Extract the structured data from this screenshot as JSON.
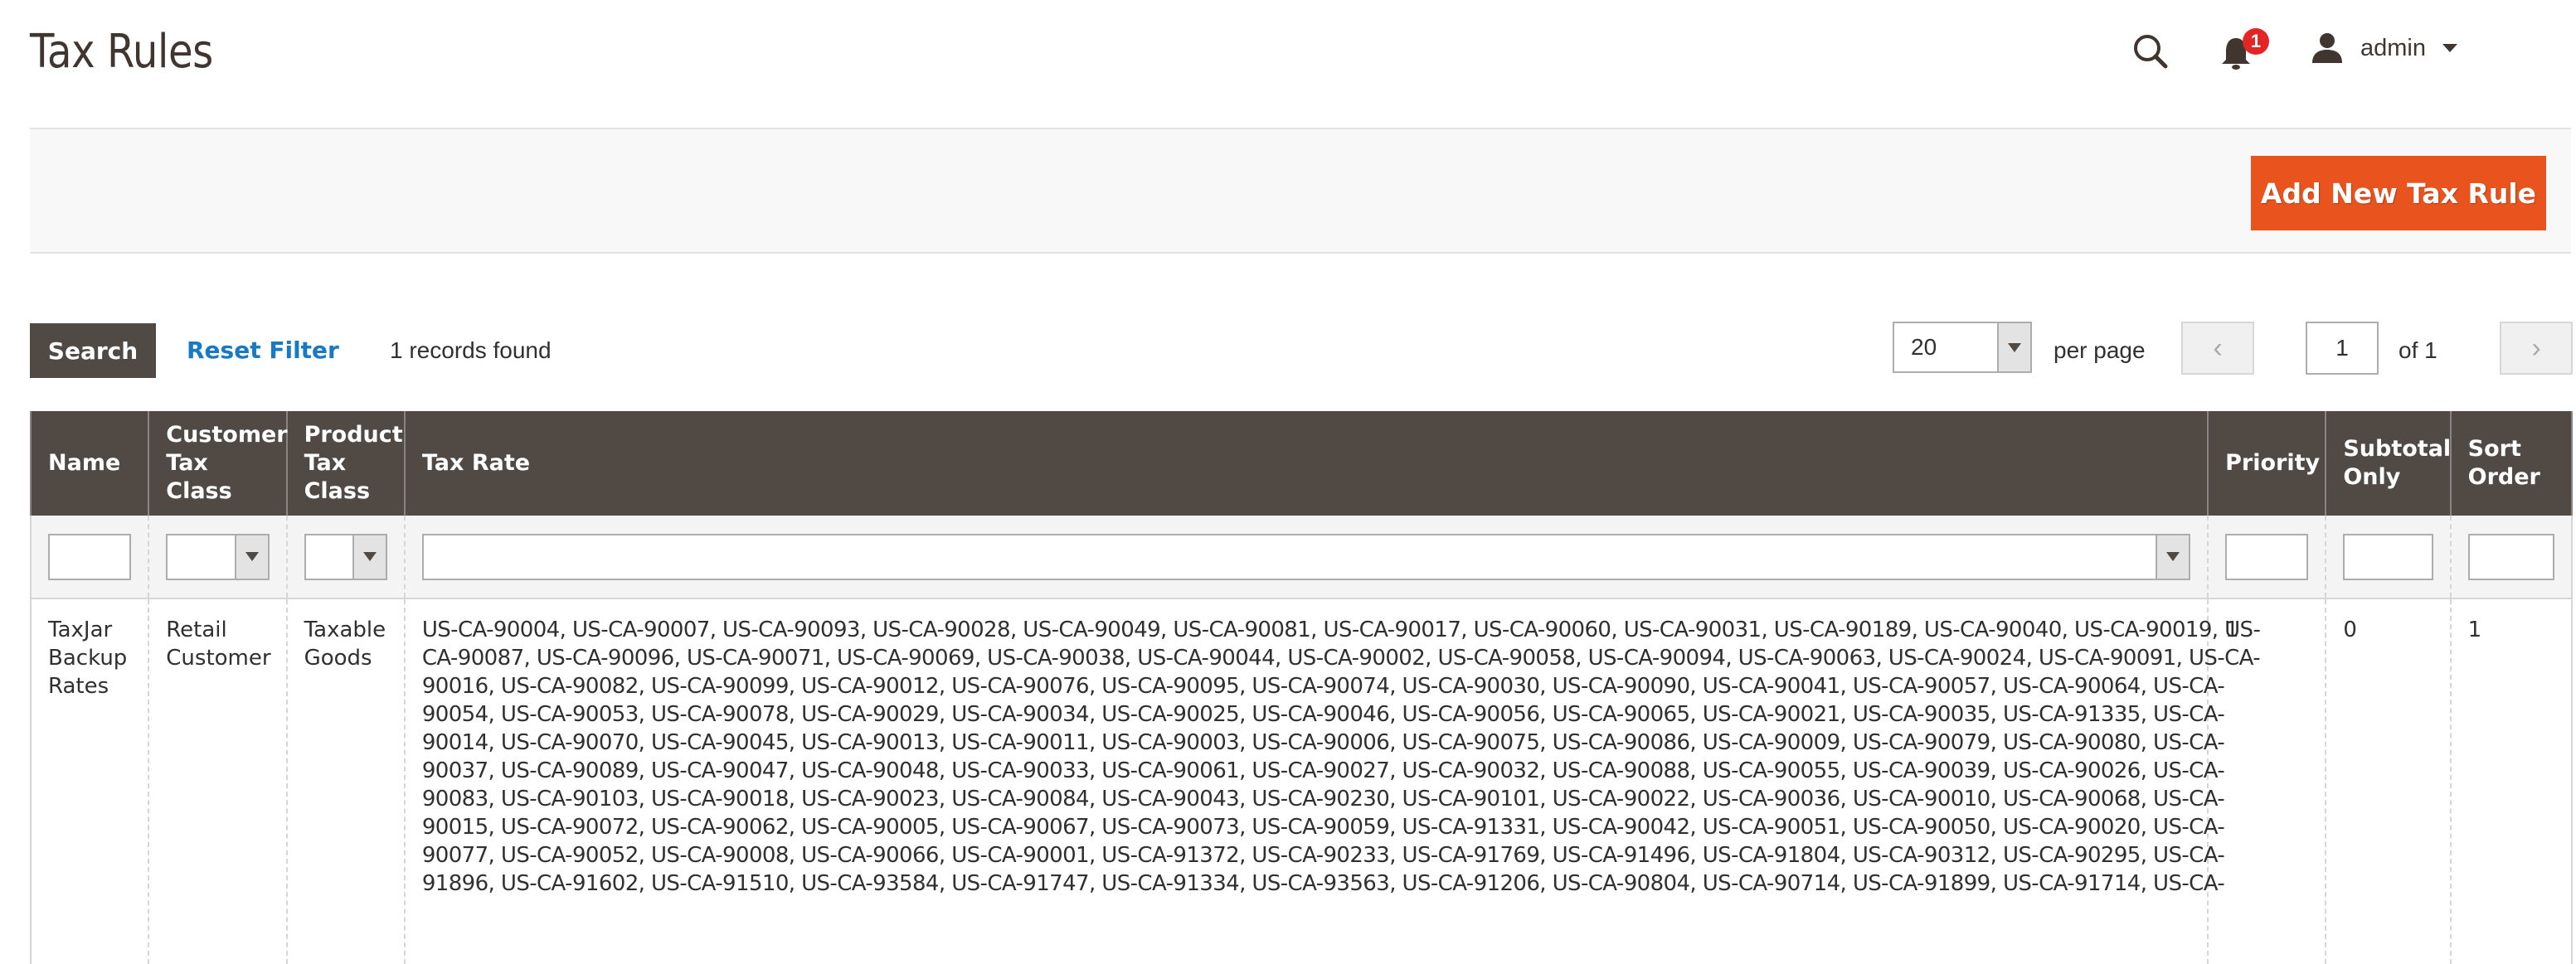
{
  "header": {
    "title": "Tax Rules",
    "notifications_count": "1",
    "user_name": "admin"
  },
  "actions": {
    "add_new_label": "Add New Tax Rule"
  },
  "toolbar": {
    "search_label": "Search",
    "reset_filter_label": "Reset Filter",
    "records_found": "1 records found",
    "per_page_value": "20",
    "per_page_label": "per page",
    "current_page": "1",
    "page_of": "of 1",
    "prev_symbol": "‹",
    "next_symbol": "›"
  },
  "table": {
    "columns": [
      {
        "label": "Name"
      },
      {
        "label": "Customer Tax Class"
      },
      {
        "label": "Product Tax Class"
      },
      {
        "label": "Tax Rate"
      },
      {
        "label": "Priority"
      },
      {
        "label": "Subtotal Only"
      },
      {
        "label": "Sort Order"
      }
    ],
    "filters": {
      "name": "",
      "customer_tax_class": "",
      "product_tax_class": "",
      "tax_rate": "",
      "priority": "",
      "subtotal_only": "",
      "sort_order": ""
    },
    "rows": [
      {
        "name": "TaxJar Backup Rates",
        "customer_tax_class": "Retail Customer",
        "product_tax_class": "Taxable Goods",
        "tax_rate_lines": [
          "US-CA-90004, US-CA-90007, US-CA-90093, US-CA-90028, US-CA-90049, US-CA-90081, US-CA-90017, US-CA-90060, US-CA-90031, US-CA-90189, US-CA-90040, US-CA-90019, US-",
          "CA-90087, US-CA-90096, US-CA-90071, US-CA-90069, US-CA-90038, US-CA-90044, US-CA-90002, US-CA-90058, US-CA-90094, US-CA-90063, US-CA-90024, US-CA-90091, US-CA-",
          "90016, US-CA-90082, US-CA-90099, US-CA-90012, US-CA-90076, US-CA-90095, US-CA-90074, US-CA-90030, US-CA-90090, US-CA-90041, US-CA-90057, US-CA-90064, US-CA-",
          "90054, US-CA-90053, US-CA-90078, US-CA-90029, US-CA-90034, US-CA-90025, US-CA-90046, US-CA-90056, US-CA-90065, US-CA-90021, US-CA-90035, US-CA-91335, US-CA-",
          "90014, US-CA-90070, US-CA-90045, US-CA-90013, US-CA-90011, US-CA-90003, US-CA-90006, US-CA-90075, US-CA-90086, US-CA-90009, US-CA-90079, US-CA-90080, US-CA-",
          "90037, US-CA-90089, US-CA-90047, US-CA-90048, US-CA-90033, US-CA-90061, US-CA-90027, US-CA-90032, US-CA-90088, US-CA-90055, US-CA-90039, US-CA-90026, US-CA-",
          "90083, US-CA-90103, US-CA-90018, US-CA-90023, US-CA-90084, US-CA-90043, US-CA-90230, US-CA-90101, US-CA-90022, US-CA-90036, US-CA-90010, US-CA-90068, US-CA-",
          "90015, US-CA-90072, US-CA-90062, US-CA-90005, US-CA-90067, US-CA-90073, US-CA-90059, US-CA-91331, US-CA-90042, US-CA-90051, US-CA-90050, US-CA-90020, US-CA-",
          "90077, US-CA-90052, US-CA-90008, US-CA-90066, US-CA-90001, US-CA-91372, US-CA-90233, US-CA-91769, US-CA-91496, US-CA-91804, US-CA-90312, US-CA-90295, US-CA-",
          "91896, US-CA-91602, US-CA-91510, US-CA-93584, US-CA-91747, US-CA-91334, US-CA-93563, US-CA-91206, US-CA-90804, US-CA-90714, US-CA-91899, US-CA-91714, US-CA-"
        ],
        "priority": "1",
        "subtotal_only": "0",
        "sort_order": "1"
      }
    ]
  },
  "colors": {
    "primary_action": "#eb5202",
    "header_bg": "#514943",
    "link": "#1979c3",
    "badge": "#e22626"
  }
}
